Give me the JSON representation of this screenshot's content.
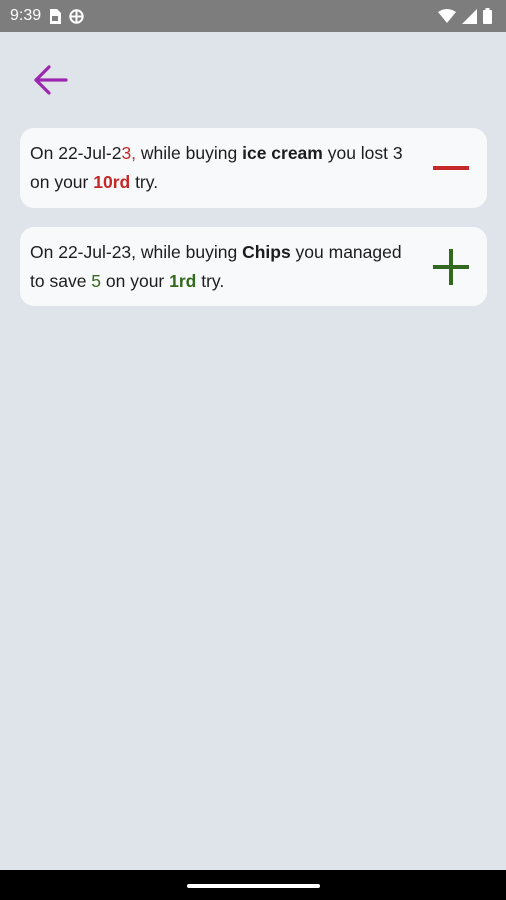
{
  "status_bar": {
    "time": "9:39",
    "icons": [
      "sim-card-icon",
      "vpn-globe-icon",
      "wifi-icon",
      "signal-icon",
      "battery-icon"
    ]
  },
  "colors": {
    "background": "#dfe3ea",
    "card": "#f8f9fb",
    "back_arrow": "#9c27b0",
    "loss_red": "#c62828",
    "save_green": "#33691e"
  },
  "header": {
    "back_icon": "arrow-left-icon"
  },
  "entries": [
    {
      "prefix": "On 22-Jul-2",
      "date_tail": "3,",
      "mid1": " while buying ",
      "item": "ice cream",
      "mid2": " you lost ",
      "amount": "3",
      "mid3": " on your ",
      "attempt": "10rd",
      "suffix": " try.",
      "action_icon": "minus-icon"
    },
    {
      "prefix": "On 22-Jul-23, while buying ",
      "item": "Chips",
      "mid1": " you managed to save ",
      "amount": "5",
      "mid2": " on your ",
      "attempt": "1rd",
      "suffix": " try.",
      "action_icon": "plus-icon"
    }
  ]
}
